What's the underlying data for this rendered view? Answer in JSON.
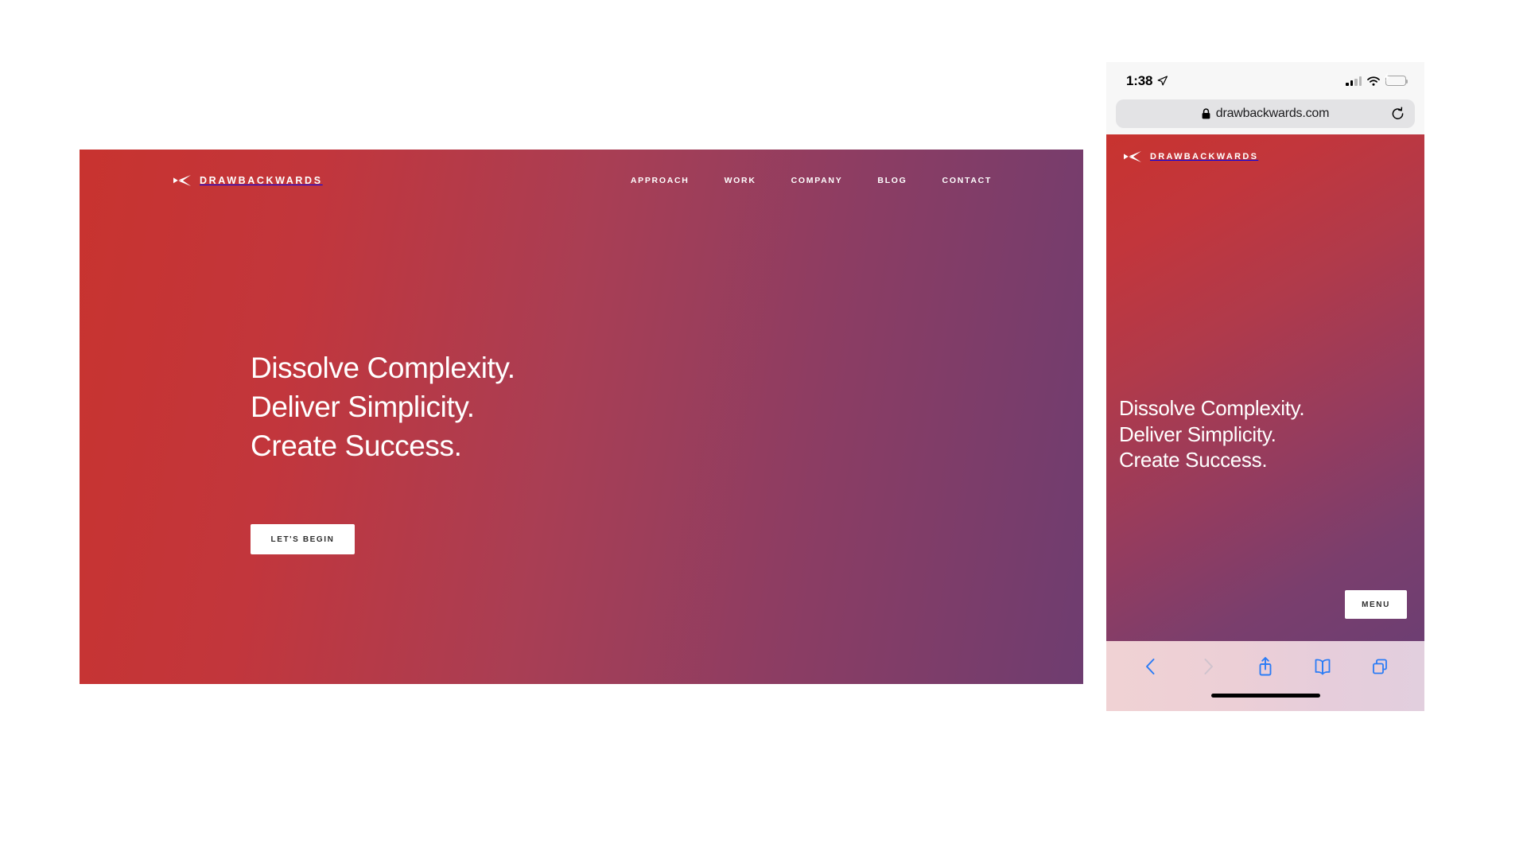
{
  "desktop": {
    "brand": {
      "logo_icon": "paper-plane-left-icon",
      "name": "DRAWBACKWARDS"
    },
    "nav": [
      {
        "label": "APPROACH"
      },
      {
        "label": "WORK"
      },
      {
        "label": "COMPANY"
      },
      {
        "label": "BLOG"
      },
      {
        "label": "CONTACT"
      }
    ],
    "hero": {
      "line1": "Dissolve Complexity.",
      "line2": "Deliver Simplicity.",
      "line3": "Create Success.",
      "cta_label": "LET'S BEGIN"
    },
    "colors": {
      "gradient_start": "#c8332f",
      "gradient_end": "#6e3d70",
      "cta_background": "#ffffff",
      "cta_text": "#2d2d2d"
    }
  },
  "phone": {
    "status_bar": {
      "time": "1:38",
      "location_icon": "location-arrow-icon",
      "signal_icon": "cellular-signal-icon",
      "signal_bars_filled": 2,
      "signal_bars_total": 4,
      "wifi_icon": "wifi-icon",
      "battery_icon": "battery-charging-icon",
      "battery_color": "#3ad442"
    },
    "browser": {
      "lock_icon": "lock-icon",
      "url": "drawbackwards.com",
      "reload_icon": "reload-icon"
    },
    "page": {
      "brand": {
        "logo_icon": "paper-plane-left-icon",
        "name": "DRAWBACKWARDS"
      },
      "hero": {
        "line1": "Dissolve Complexity.",
        "line2": "Deliver Simplicity.",
        "line3": "Create Success."
      },
      "menu_label": "MENU"
    },
    "toolbar": {
      "back_icon": "chevron-left-icon",
      "forward_icon": "chevron-right-icon",
      "share_icon": "share-icon",
      "bookmarks_icon": "book-icon",
      "tabs_icon": "tabs-icon",
      "accent_color": "#2b7cf6",
      "disabled_color": "#cfc3cd"
    },
    "home_indicator": "home-indicator-bar"
  }
}
